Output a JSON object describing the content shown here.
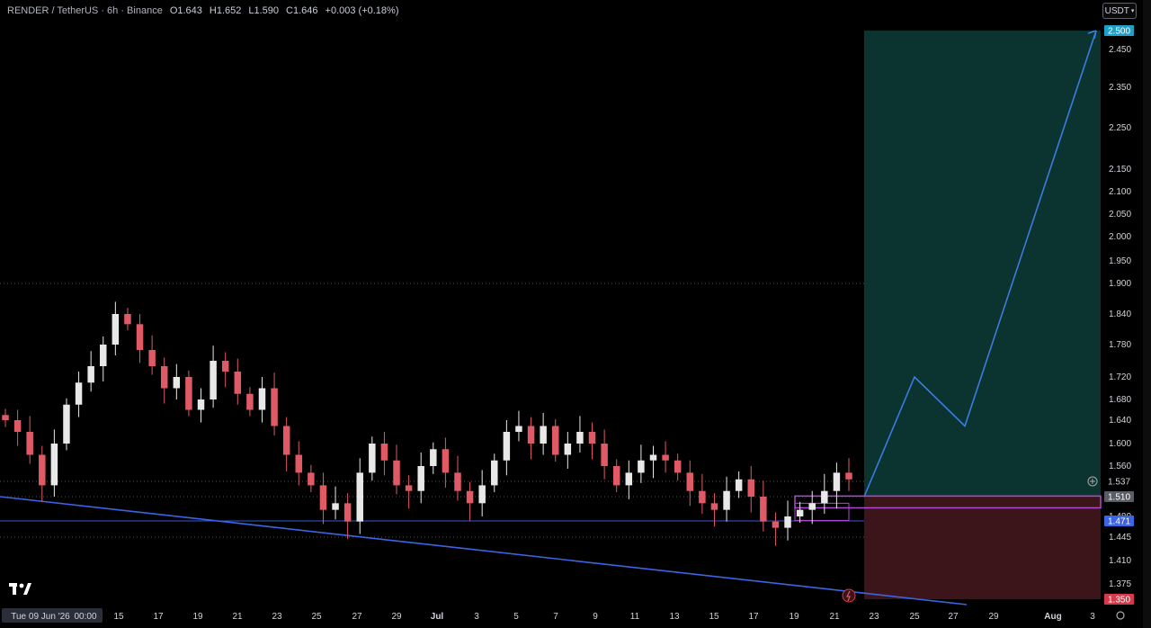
{
  "legend": {
    "symbol": "RENDER / TetherUS · 6h · Binance",
    "open": "O1.643",
    "high": "H1.652",
    "low": "L1.590",
    "close": "C1.646",
    "change": "+0.003 (+0.18%)"
  },
  "currency": {
    "label": "USDT",
    "icon": "chevron-down-icon"
  },
  "colors": {
    "up": "#e8e8e8",
    "down": "#e05a66",
    "trendline": "#3b64e6",
    "projection": "#3a7de0",
    "profit_zone": "#0b3330",
    "loss_zone": "#3b1519",
    "current_price_badge": "#5a5d66",
    "target_badge": "#1fa0c8",
    "stop_badge": "#d43a49"
  },
  "chart_data": {
    "type": "candlestick",
    "title": "RENDER / TetherUS · 6h · Binance",
    "y_ticks": [
      "2.450",
      "2.350",
      "2.250",
      "2.150",
      "2.100",
      "2.050",
      "2.000",
      "1.950",
      "1.900",
      "1.840",
      "1.780",
      "1.720",
      "1.680",
      "1.640",
      "1.600",
      "1.560",
      "1.480",
      "1.445",
      "1.410",
      "1.375"
    ],
    "price_labels": {
      "target": "2.500",
      "current": "1.537",
      "entry": "1.510",
      "horizontal_line": "1.471",
      "stop": "1.350"
    },
    "x_ticks": [
      "Tue 09 Jun '26",
      "00:00",
      "15",
      "17",
      "19",
      "21",
      "23",
      "25",
      "27",
      "29",
      "Jul",
      "3",
      "5",
      "7",
      "9",
      "11",
      "13",
      "15",
      "17",
      "19",
      "21",
      "23",
      "25",
      "27",
      "29",
      "Aug",
      "3"
    ],
    "close_path": [
      1.64,
      1.62,
      1.58,
      1.53,
      1.6,
      1.67,
      1.71,
      1.74,
      1.78,
      1.84,
      1.82,
      1.77,
      1.74,
      1.7,
      1.72,
      1.66,
      1.68,
      1.75,
      1.73,
      1.69,
      1.66,
      1.7,
      1.63,
      1.58,
      1.55,
      1.53,
      1.49,
      1.5,
      1.47,
      1.55,
      1.6,
      1.57,
      1.53,
      1.52,
      1.56,
      1.59,
      1.55,
      1.52,
      1.5,
      1.53,
      1.57,
      1.62,
      1.63,
      1.6,
      1.63,
      1.58,
      1.6,
      1.62,
      1.6,
      1.56,
      1.53,
      1.55,
      1.57,
      1.58,
      1.57,
      1.55,
      1.52,
      1.5,
      1.49,
      1.52,
      1.54,
      1.51,
      1.47,
      1.46,
      1.48,
      1.49,
      1.5,
      1.52,
      1.55,
      1.54
    ],
    "projection_path": [
      1.51,
      1.72,
      1.63,
      2.5
    ],
    "trendline": [
      1.51,
      1.35
    ],
    "horizontal_levels": [
      1.9,
      1.537,
      1.51,
      1.471,
      1.445
    ],
    "long_position": {
      "entry": 1.51,
      "target": 2.5,
      "stop": 1.35
    },
    "zones": [
      {
        "top": 1.51,
        "bottom": 1.49
      },
      {
        "top": 1.5,
        "bottom": 1.47
      }
    ]
  }
}
